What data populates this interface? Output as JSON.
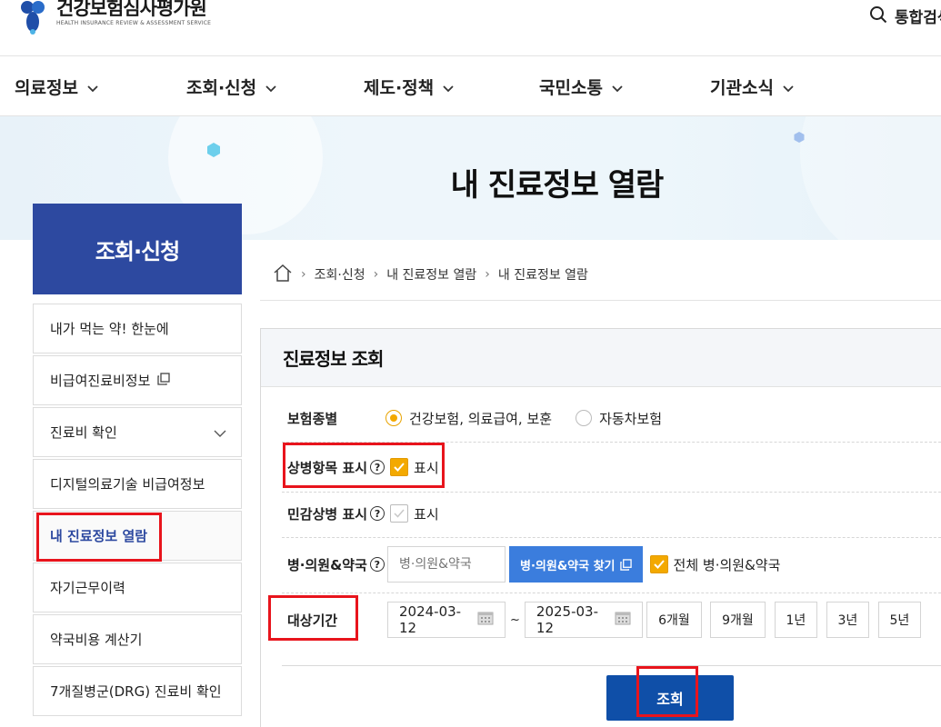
{
  "header": {
    "logo_kor": "건강보험심사평가원",
    "logo_eng": "HEALTH INSURANCE REVIEW & ASSESSMENT SERVICE",
    "search_label": "통합검색",
    "search_icon": "search-icon"
  },
  "gnb": {
    "items": [
      {
        "label": "의료정보"
      },
      {
        "label": "조회·신청"
      },
      {
        "label": "제도·정책"
      },
      {
        "label": "국민소통"
      },
      {
        "label": "기관소식"
      }
    ]
  },
  "banner": {
    "title": "내 진료정보 열람"
  },
  "sidebar": {
    "heading": "조회·신청",
    "items": [
      {
        "label": "내가 먹는 약! 한눈에"
      },
      {
        "label": "비급여진료비정보"
      },
      {
        "label": "진료비 확인"
      },
      {
        "label": "디지털의료기술 비급여정보"
      },
      {
        "label": "내 진료정보 열람"
      },
      {
        "label": "자기근무이력"
      },
      {
        "label": "약국비용 계산기"
      },
      {
        "label": "7개질병군(DRG) 진료비 확인"
      }
    ]
  },
  "breadcrumb": {
    "items": [
      "조회·신청",
      "내 진료정보 열람",
      "내 진료정보 열람"
    ]
  },
  "panel": {
    "title": "진료정보 조회",
    "insurance": {
      "label": "보험종별",
      "options": [
        "건강보험, 의료급여, 보훈",
        "자동차보험"
      ],
      "selected": "건강보험, 의료급여, 보훈"
    },
    "disease_display": {
      "label": "상병항목 표시",
      "help": "?",
      "checkbox_label": "표시",
      "checked": true
    },
    "sensitive_display": {
      "label": "민감상병 표시",
      "help": "?",
      "checkbox_label": "표시",
      "checked": false
    },
    "hospital": {
      "label": "병·의원&약국",
      "help": "?",
      "placeholder": "병·의원&약국",
      "find_button": "병·의원&약국 찾기",
      "all_label": "전체 병·의원&약국",
      "all_checked": true
    },
    "period": {
      "label": "대상기간",
      "start": "2024-03-12",
      "tilde": "~",
      "end": "2025-03-12",
      "buttons": [
        "6개월",
        "9개월",
        "1년",
        "3년",
        "5년"
      ]
    },
    "search_button": "조회"
  },
  "colors": {
    "sidebar_head": "#2d49a0",
    "accent_yellow": "#f3a900",
    "blue_button": "#3b7ddd",
    "search_button": "#0f4fa8",
    "highlight_red": "#e8141c"
  }
}
